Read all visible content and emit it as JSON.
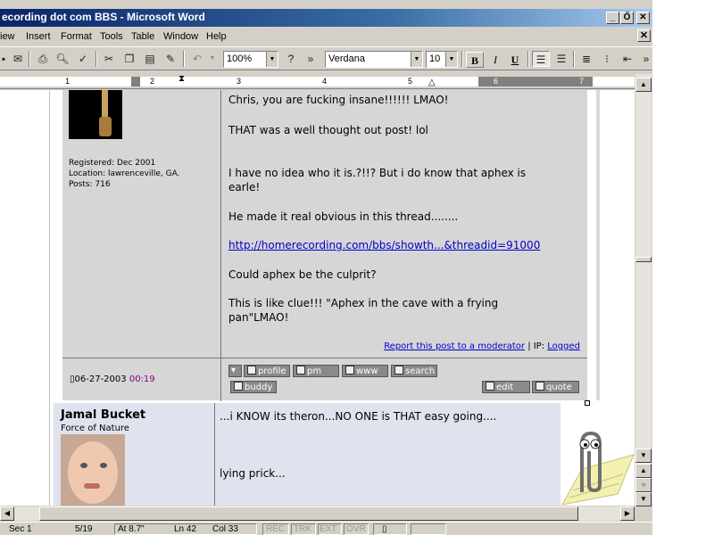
{
  "window": {
    "title": "ecording dot com BBS - Microsoft Word",
    "minimize": "_",
    "restore": "Ő",
    "close": "✕"
  },
  "menu": {
    "items": [
      "View",
      "Insert",
      "Format",
      "Tools",
      "Table",
      "Window",
      "Help"
    ],
    "display_first": "iew",
    "close_doc": "✕"
  },
  "toolbar": {
    "zoom": "100%",
    "font": "Verdana",
    "font_size": "10",
    "bold": "B",
    "italic": "I",
    "underline": "U",
    "overflow": "»"
  },
  "ruler": {
    "numbers": [
      "1",
      "2",
      "3",
      "4",
      "5",
      "6",
      "7"
    ]
  },
  "post1": {
    "registered": "Registered: Dec 2001",
    "location": "Location: lawrenceville, GA.",
    "posts": "Posts: 716",
    "lines": [
      "Chris, you are fucking insane!!!!!! LMAO!",
      "THAT was a well thought out post! lol",
      "I have no idea who it is.?!!? But i do know that aphex is",
      "earle!",
      "He made it real obvious in this thread........",
      "http://homerecording.com/bbs/showth...&threadid=91000",
      "Could aphex be the culprit?",
      "This is like clue!!! \"Aphex in the cave with a frying",
      "pan\"LMAO!"
    ],
    "report_link": "Report this post to a moderator",
    "ip_label": "| IP:",
    "ip_link": "Logged",
    "date": "06-27-2003",
    "time": "00:19",
    "buttons": {
      "profile": "profile",
      "pm": "pm",
      "www": "www",
      "search": "search",
      "buddy": "buddy",
      "edit": "edit",
      "quote": "quote"
    }
  },
  "post2": {
    "name": "Jamal Bucket",
    "rank": "Force of Nature",
    "line1": "...i KNOW its theron...NO ONE is THAT easy going....",
    "line2": "lying prick..."
  },
  "status": {
    "sec": "Sec 1",
    "page": "5/19",
    "at": "At 8.7\"",
    "ln": "Ln 42",
    "col": "Col 33",
    "rec": "REC",
    "trk": "TRK",
    "ext": "EXT",
    "ovr": "OVR"
  }
}
